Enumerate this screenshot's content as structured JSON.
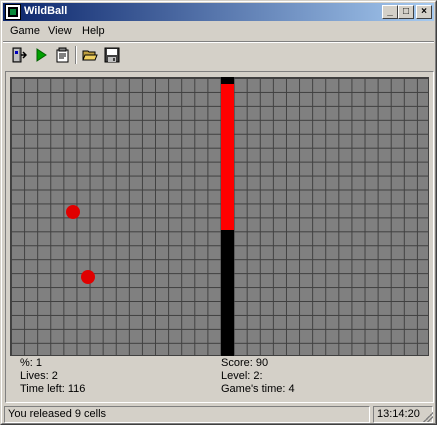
{
  "window": {
    "title": "WildBall",
    "minimize_label": "_",
    "maximize_label": "□",
    "close_label": "×"
  },
  "menu": {
    "items": [
      "Game",
      "View",
      "Help"
    ]
  },
  "toolbar": {
    "buttons": [
      {
        "icon": "exit-door-icon"
      },
      {
        "icon": "play-icon"
      },
      {
        "icon": "properties-icon"
      },
      {
        "icon": "open-folder-icon"
      },
      {
        "icon": "save-disk-icon"
      }
    ]
  },
  "game": {
    "grid_cols": 32,
    "grid_rows": 20,
    "colors": {
      "field": "#808080",
      "grid_lines": "#404040",
      "wall": "#000000",
      "growing_wall": "#ff0000",
      "ball": "#e00000"
    },
    "balls_count": 2
  },
  "stats": {
    "percent": "%: 1",
    "lives": "Lives: 2",
    "time_left": "Time left: 116",
    "score": "Score: 90",
    "level": "Level: 2:",
    "games_time": "Game's time: 4"
  },
  "statusbar": {
    "message": "You released 9 cells",
    "clock": "13:14:20"
  }
}
